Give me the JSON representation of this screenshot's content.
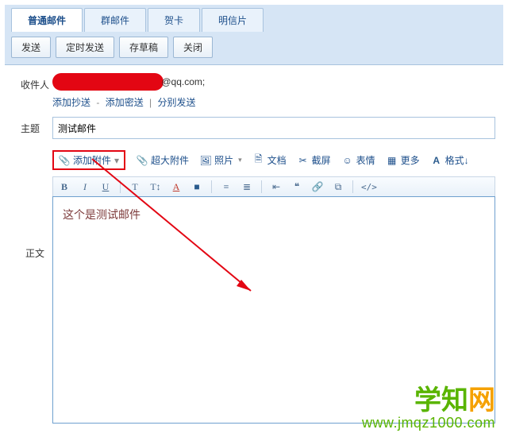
{
  "tabs": {
    "normal": "普通邮件",
    "group": "群邮件",
    "greeting": "贺卡",
    "postcard": "明信片"
  },
  "buttons": {
    "send": "发送",
    "timed": "定时发送",
    "draft": "存草稿",
    "close": "关闭"
  },
  "labels": {
    "recipient": "收件人",
    "subject": "主题",
    "body": "正文"
  },
  "recipient": {
    "suffix": "@qq.com;",
    "add_cc": "添加抄送",
    "add_bcc": "添加密送",
    "separate_send": "分别发送",
    "dash": " - ",
    "pipe": " | "
  },
  "subject": {
    "value": "测试邮件"
  },
  "attach": {
    "main": "添加附件",
    "main_drop": "▾",
    "large": "超大附件",
    "photo": "照片",
    "doc": "文档",
    "screenshot": "截屏",
    "emoji": "表情",
    "more": "更多",
    "format": "格式↓"
  },
  "toolbar": {
    "bold": "B",
    "italic": "I",
    "underline": "U",
    "fontsize": "T",
    "fontsize2": "T↕",
    "color": "A",
    "bg": "■",
    "align": "≡",
    "list": "≣",
    "indent": "⇤",
    "quote": "❝",
    "link": "🔗",
    "image": "⧉",
    "source": "</>"
  },
  "body_text": "这个是测试邮件",
  "watermark": {
    "line1a": "学知",
    "line1b": "网",
    "line2": "www.jmqz1000.com"
  }
}
